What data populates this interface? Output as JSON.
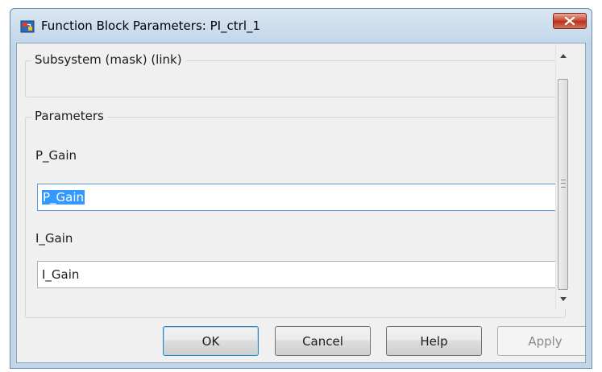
{
  "window": {
    "title": "Function Block Parameters: PI_ctrl_1"
  },
  "mask": {
    "header": "Subsystem (mask) (link)"
  },
  "parameters": {
    "legend": "Parameters",
    "fields": [
      {
        "label": "P_Gain",
        "value": "P_Gain"
      },
      {
        "label": "I_Gain",
        "value": "I_Gain"
      }
    ]
  },
  "buttons": {
    "ok": "OK",
    "cancel": "Cancel",
    "help": "Help",
    "apply": "Apply"
  },
  "colors": {
    "selection": "#3399ff",
    "default_button_border": "#3c7fb1",
    "close_button": "#c7432c"
  }
}
